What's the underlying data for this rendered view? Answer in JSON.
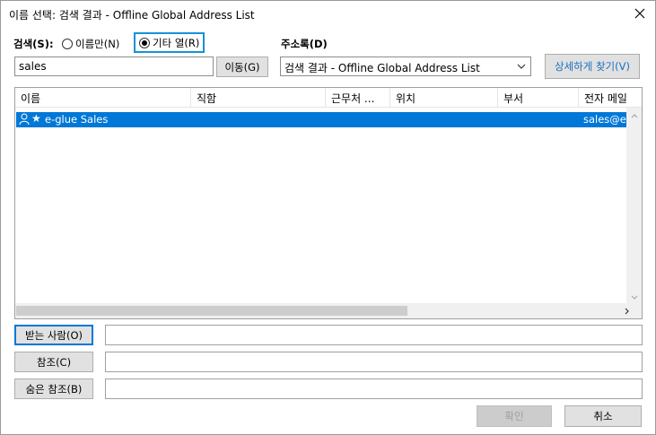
{
  "window": {
    "title": "이름 선택: 검색 결과 - Offline Global Address List",
    "close_icon": "close-icon"
  },
  "search": {
    "label": "검색(S):",
    "radio_name_only": {
      "label": "이름만(N)",
      "checked": false
    },
    "radio_more_columns": {
      "label": "기타 열(R)",
      "checked": true
    },
    "input_value": "sales",
    "go_button": "이동(G)"
  },
  "address_book": {
    "label": "주소록(D)",
    "selected": "검색 결과 - Offline Global Address List",
    "advanced_find_button": "상세하게 찾기(V)"
  },
  "list": {
    "columns": [
      "이름",
      "직함",
      "근무처 ...",
      "위치",
      "부서",
      "전자 메일"
    ],
    "rows": [
      {
        "name": "e-glue Sales",
        "icon": "contact-star-icon",
        "email": "sales@e",
        "selected": true
      }
    ]
  },
  "recipients": {
    "to_button": "받는 사람(O)",
    "cc_button": "참조(C)",
    "bcc_button": "숨은 참조(B)",
    "to_value": "",
    "cc_value": "",
    "bcc_value": ""
  },
  "footer": {
    "ok_button": "확인",
    "ok_enabled": false,
    "cancel_button": "취소"
  },
  "colors": {
    "accent": "#0078d7",
    "focus_outline": "#1493d6",
    "selected_row": "#0078d7"
  }
}
